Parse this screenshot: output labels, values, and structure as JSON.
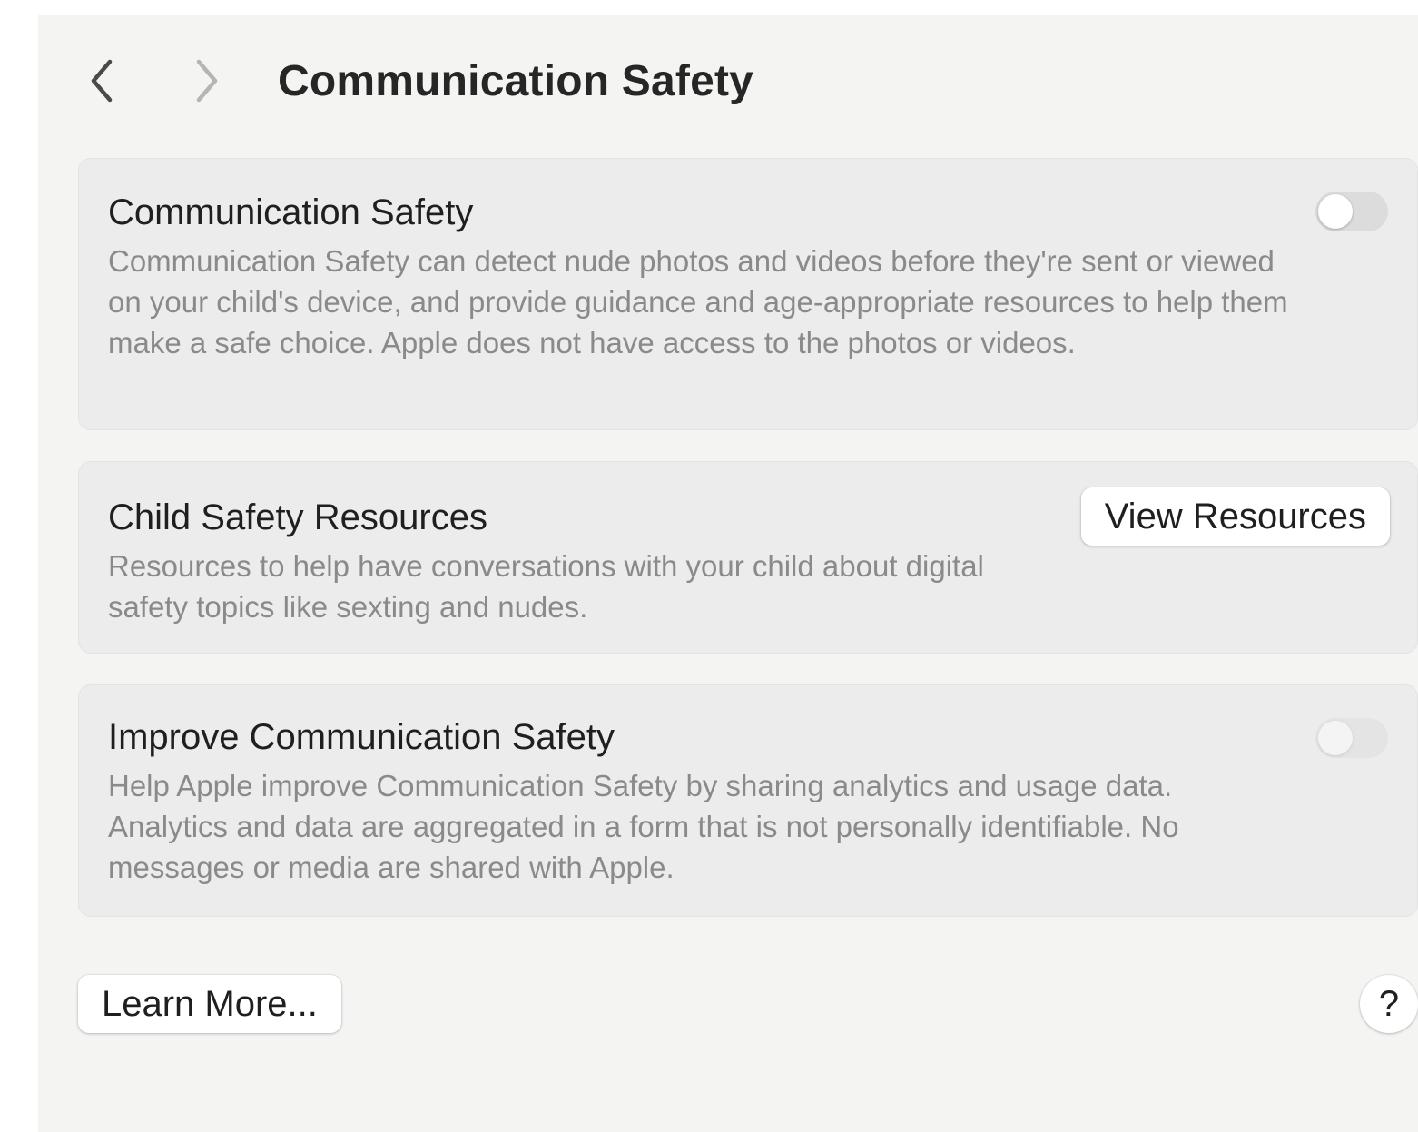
{
  "toolbar": {
    "back_icon": "chevron-left-icon",
    "forward_icon": "chevron-right-icon",
    "title": "Communication Safety"
  },
  "sections": [
    {
      "title": "Communication Safety",
      "description": "Communication Safety can detect nude photos and videos before they're sent or viewed on your child's device, and provide guidance and age-appropriate resources to help them make a safe choice. Apple does not have access to the photos or videos.",
      "control": "toggle",
      "toggle_on": false,
      "toggle_enabled": true
    },
    {
      "title": "Child Safety Resources",
      "description": "Resources to help have conversations with your child about digital safety topics like sexting and nudes.",
      "control": "button",
      "button_label": "View Resources"
    },
    {
      "title": "Improve Communication Safety",
      "description": "Help Apple improve Communication Safety by sharing analytics and usage data. Analytics and data are aggregated in a form that is not personally identifiable. No messages or media are shared with Apple.",
      "control": "toggle",
      "toggle_on": false,
      "toggle_enabled": false
    }
  ],
  "footer": {
    "learn_more_label": "Learn More...",
    "help_label": "?"
  },
  "colors": {
    "window_bg": "#f4f4f3",
    "card_bg": "#ececec",
    "title_text": "#1f1f1f",
    "secondary_text": "#8a8a8a",
    "toggle_off": "#dcdcdc"
  }
}
